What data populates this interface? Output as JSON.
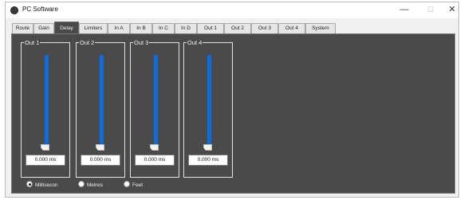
{
  "window": {
    "title": "PC Software",
    "controls": {
      "minimize": "—",
      "maximize": "☐",
      "close": "✕"
    }
  },
  "tabs": [
    {
      "label": "Route",
      "active": false
    },
    {
      "label": "Gain",
      "active": false
    },
    {
      "label": "Delay",
      "active": true
    },
    {
      "label": "Limiters",
      "active": false
    },
    {
      "label": "In A",
      "active": false
    },
    {
      "label": "In B",
      "active": false
    },
    {
      "label": "In C",
      "active": false
    },
    {
      "label": "In D",
      "active": false
    },
    {
      "label": "Out 1",
      "active": false
    },
    {
      "label": "Out 2",
      "active": false
    },
    {
      "label": "Out 3",
      "active": false
    },
    {
      "label": "Out 4",
      "active": false
    },
    {
      "label": "System",
      "active": false
    }
  ],
  "delay": {
    "outputs": [
      {
        "label": "Out 1",
        "value": "0.000 ms",
        "slider_level": 0
      },
      {
        "label": "Out 2",
        "value": "0.000 ms",
        "slider_level": 0
      },
      {
        "label": "Out 3",
        "value": "0.000 ms",
        "slider_level": 0
      },
      {
        "label": "Out 4",
        "value": "0.000 ms",
        "slider_level": 0
      }
    ],
    "units": [
      {
        "label": "Millisecon",
        "checked": true
      },
      {
        "label": "Metres",
        "checked": false
      },
      {
        "label": "Feet",
        "checked": false
      }
    ]
  },
  "colors": {
    "panel_bg": "#4a4a4a",
    "slider_track": "#0a6cde",
    "active_tab_bg": "#4a4a4a"
  }
}
